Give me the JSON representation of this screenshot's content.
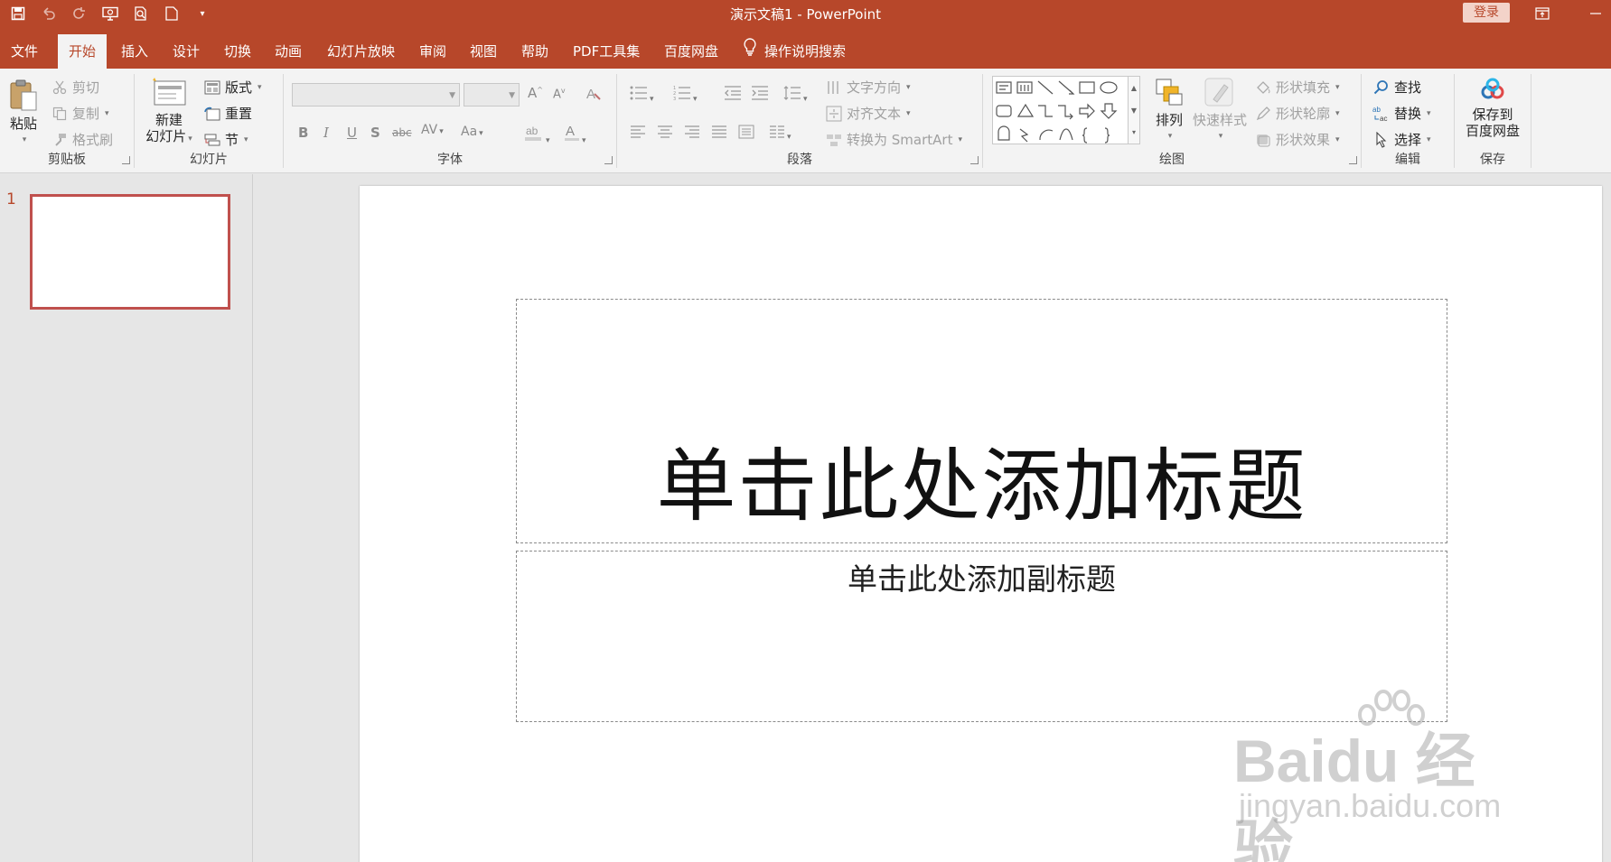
{
  "window": {
    "title": "演示文稿1  -  PowerPoint",
    "login_label": "登录"
  },
  "qat": {
    "icons": [
      "save-icon",
      "undo-icon",
      "redo-icon",
      "slideshow-icon",
      "print-preview-icon",
      "new-icon",
      "customize-icon"
    ]
  },
  "tabs": {
    "file": "文件",
    "home": "开始",
    "insert": "插入",
    "design": "设计",
    "transitions": "切换",
    "animations": "动画",
    "slideshow": "幻灯片放映",
    "review": "审阅",
    "view": "视图",
    "help": "帮助",
    "pdf": "PDF工具集",
    "baidu": "百度网盘",
    "search": "操作说明搜索"
  },
  "ribbon": {
    "clipboard": {
      "label": "剪贴板",
      "paste": "粘贴",
      "cut": "剪切",
      "copy": "复制",
      "format_painter": "格式刷"
    },
    "slides": {
      "label": "幻灯片",
      "new_slide_line1": "新建",
      "new_slide_line2": "幻灯片",
      "layout": "版式",
      "reset": "重置",
      "section": "节"
    },
    "font": {
      "label": "字体"
    },
    "paragraph": {
      "label": "段落",
      "text_direction": "文字方向",
      "align_text": "对齐文本",
      "convert_smartart": "转换为 SmartArt"
    },
    "drawing": {
      "label": "绘图",
      "arrange": "排列",
      "quick_styles": "快速样式",
      "shape_fill": "形状填充",
      "shape_outline": "形状轮廓",
      "shape_effects": "形状效果"
    },
    "editing": {
      "label": "编辑",
      "find": "查找",
      "replace": "替换",
      "select": "选择"
    },
    "save": {
      "label": "保存",
      "save_to_line1": "保存到",
      "save_to_line2": "百度网盘"
    }
  },
  "thumbnails": {
    "slide_number": "1"
  },
  "slide": {
    "title_placeholder": "单击此处添加标题",
    "subtitle_placeholder": "单击此处添加副标题"
  },
  "watermark": {
    "brand": "Baidu 经验",
    "url": "jingyan.baidu.com"
  },
  "colors": {
    "accent": "#b7472a",
    "ribbon_bg": "#f3f3f3",
    "workspace_bg": "#e6e6e6"
  }
}
